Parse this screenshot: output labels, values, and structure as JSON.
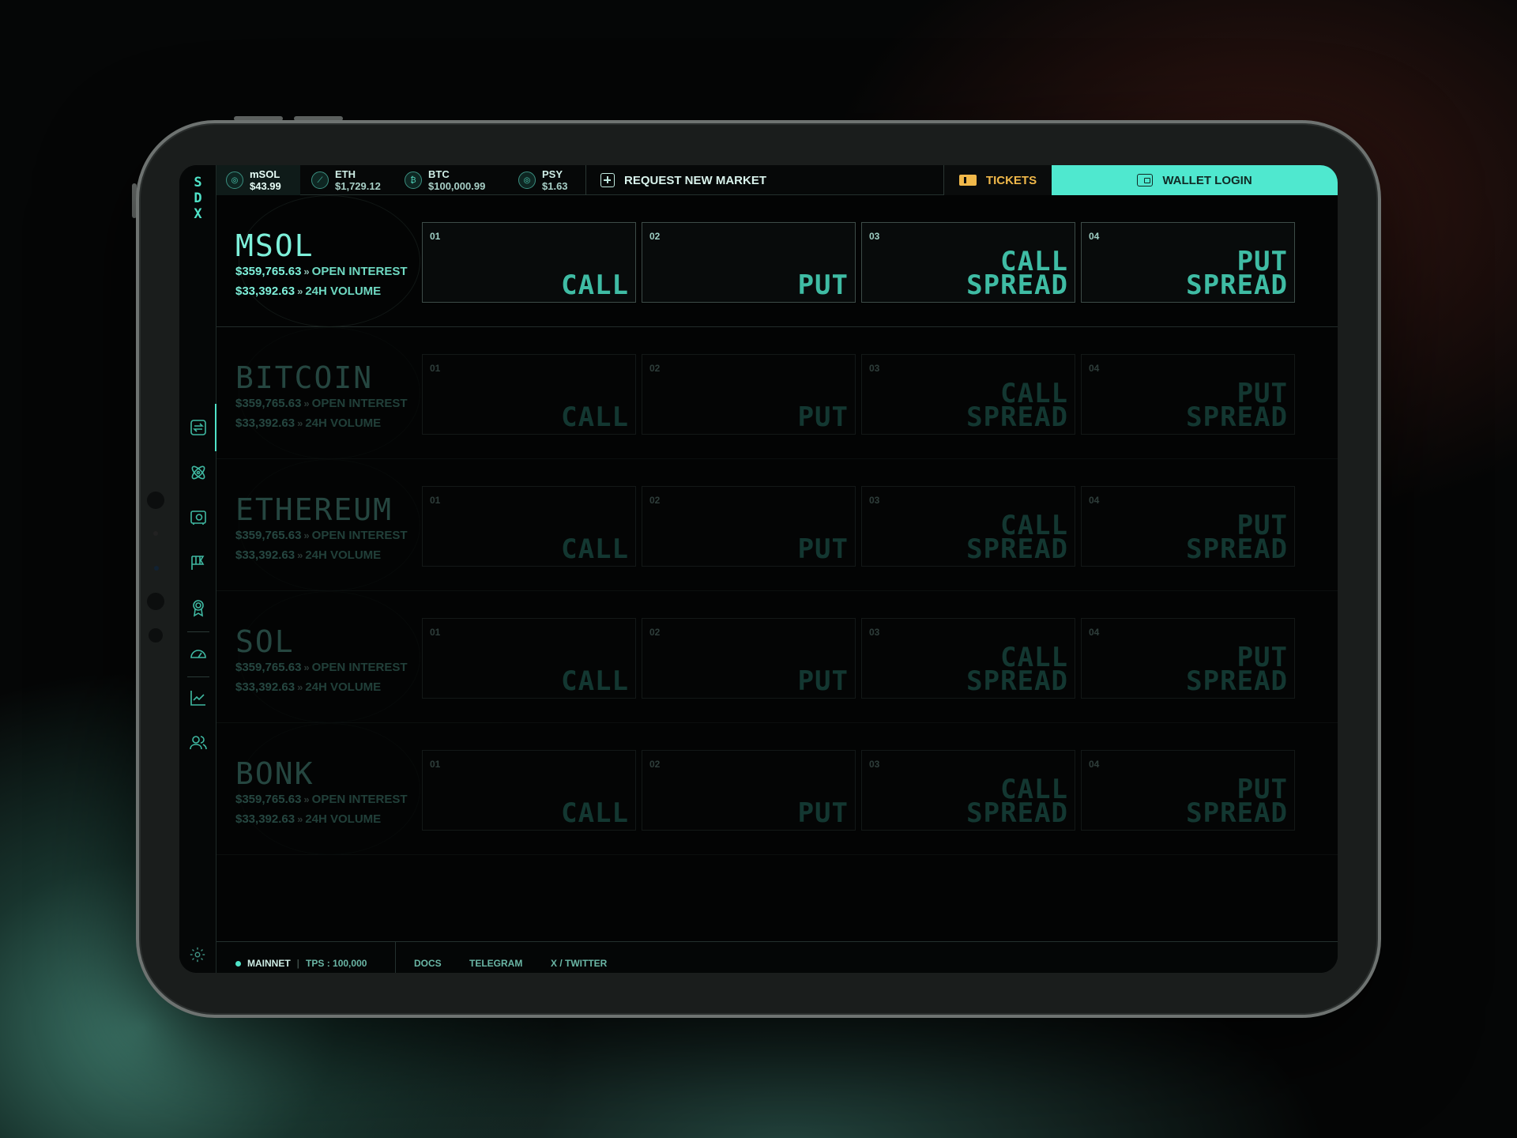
{
  "app": {
    "logo_letters": [
      "S",
      "D",
      "X"
    ]
  },
  "topbar": {
    "tickers": [
      {
        "symbol": "mSOL",
        "price": "$43.99",
        "icon": "msol-coin-icon",
        "active": true
      },
      {
        "symbol": "ETH",
        "price": "$1,729.12",
        "icon": "eth-coin-icon",
        "active": false
      },
      {
        "symbol": "BTC",
        "price": "$100,000.99",
        "icon": "btc-coin-icon",
        "active": false
      },
      {
        "symbol": "PSY",
        "price": "$1.63",
        "icon": "psy-coin-icon",
        "active": false
      }
    ],
    "request_market": "REQUEST NEW MARKET",
    "tickets": "TICKETS",
    "wallet_login": "WALLET LOGIN"
  },
  "markets": [
    {
      "name": "MSOL",
      "open_interest": "$359,765.63",
      "volume": "$33,392.63",
      "active": true
    },
    {
      "name": "BITCOIN",
      "open_interest": "$359,765.63",
      "volume": "$33,392.63",
      "active": false
    },
    {
      "name": "ETHEREUM",
      "open_interest": "$359,765.63",
      "volume": "$33,392.63",
      "active": false
    },
    {
      "name": "SOL",
      "open_interest": "$359,765.63",
      "volume": "$33,392.63",
      "active": false
    },
    {
      "name": "BONK",
      "open_interest": "$359,765.63",
      "volume": "$33,392.63",
      "active": false
    }
  ],
  "labels": {
    "open_interest": "OPEN INTEREST",
    "volume": "24H VOLUME",
    "arrow": "»"
  },
  "options": [
    {
      "num": "01",
      "line1": "",
      "line2": "CALL"
    },
    {
      "num": "02",
      "line1": "",
      "line2": "PUT"
    },
    {
      "num": "03",
      "line1": "CALL",
      "line2": "SPREAD"
    },
    {
      "num": "04",
      "line1": "PUT",
      "line2": "SPREAD"
    }
  ],
  "footer": {
    "network": "MAINNET",
    "tps": "TPS : 100,000",
    "links": [
      "DOCS",
      "TELEGRAM",
      "X / TWITTER"
    ]
  },
  "colors": {
    "accent": "#4fe8cf",
    "tickets": "#f0b84a",
    "background": "#030404"
  },
  "rail_icons": [
    "swap-icon",
    "atom-icon",
    "vault-icon",
    "flag-icon",
    "award-icon",
    "speedometer-icon",
    "chart-line-icon",
    "users-icon"
  ]
}
